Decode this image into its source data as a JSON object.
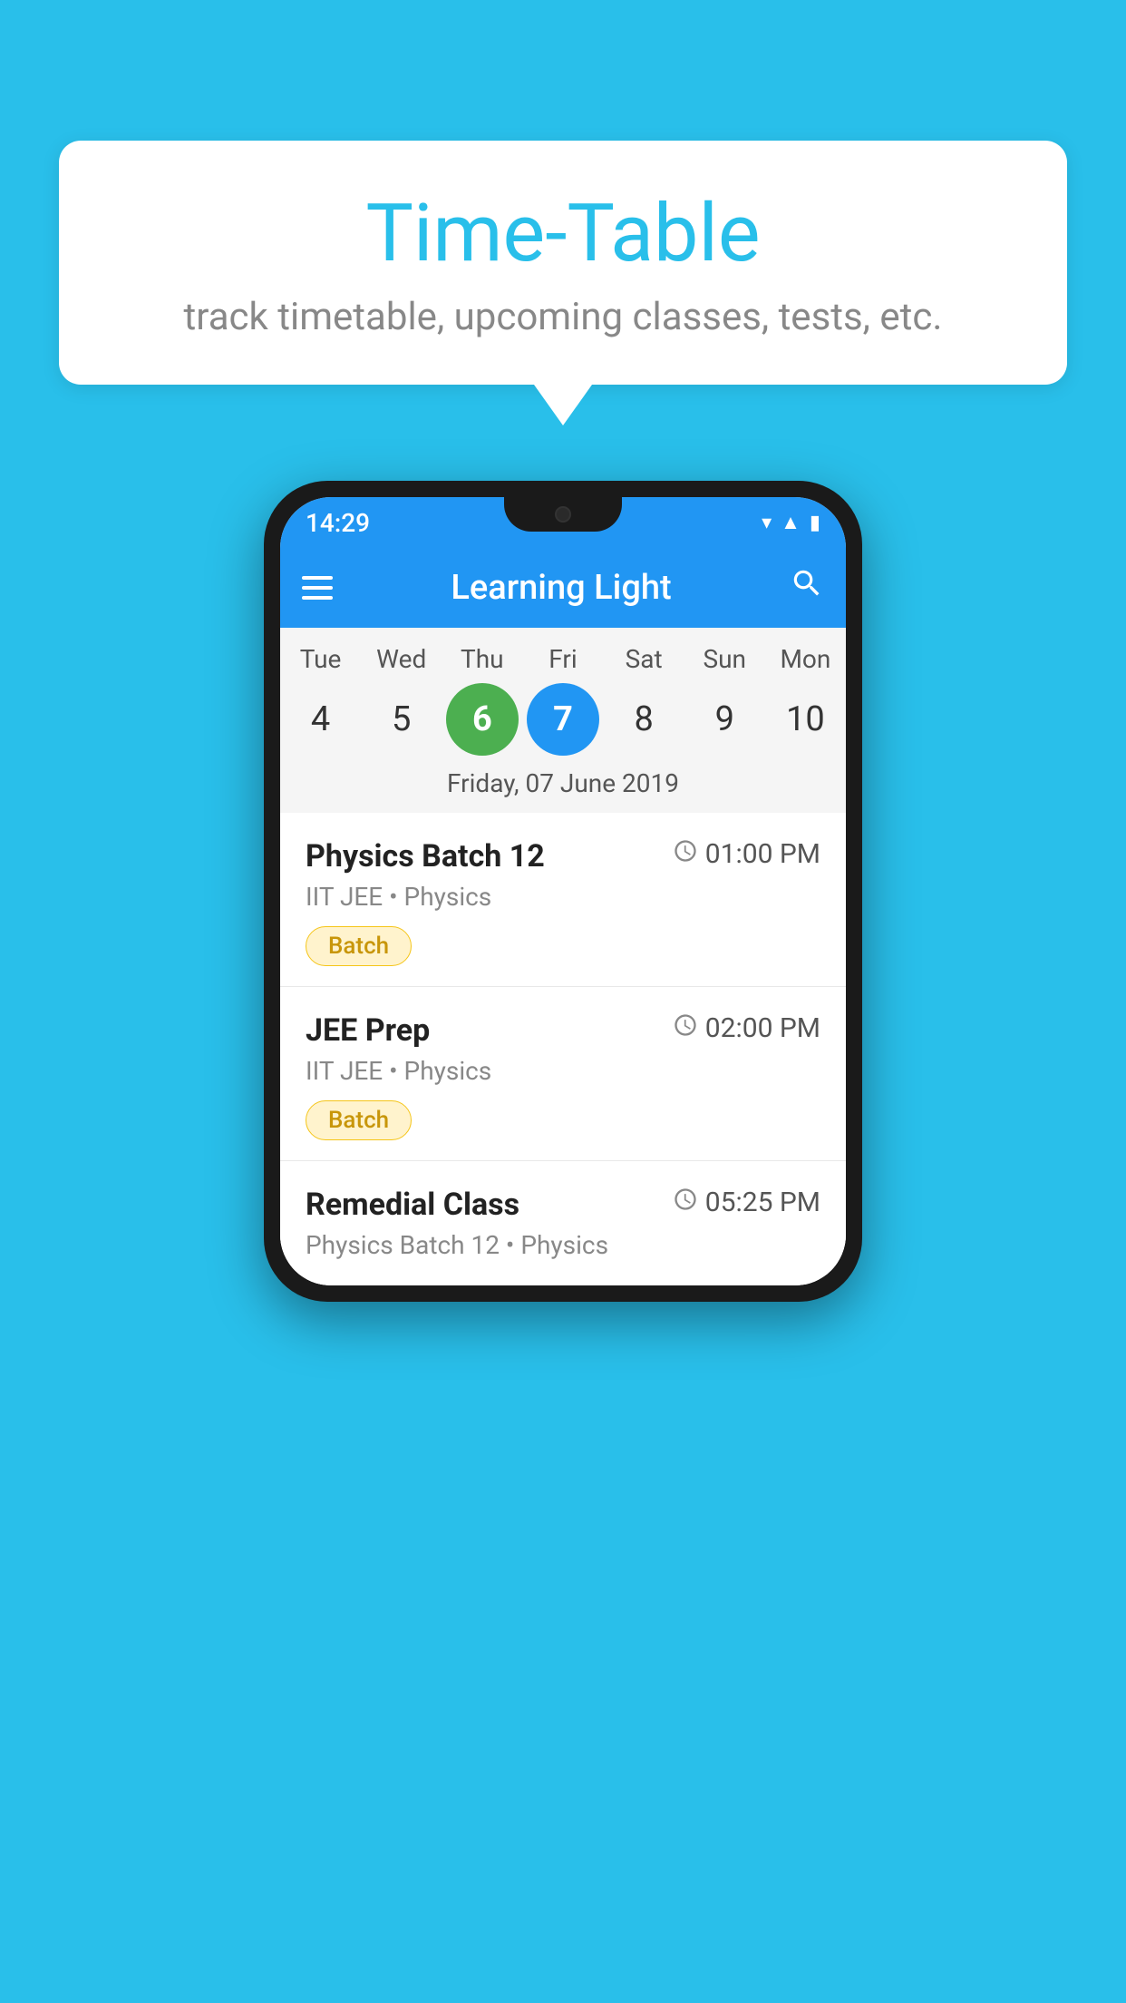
{
  "background_color": "#29BFEA",
  "speech_bubble": {
    "title": "Time-Table",
    "subtitle": "track timetable, upcoming classes, tests, etc."
  },
  "phone": {
    "status_bar": {
      "time": "14:29"
    },
    "app_bar": {
      "title": "Learning Light"
    },
    "calendar": {
      "days": [
        {
          "label": "Tue",
          "number": "4",
          "state": "normal"
        },
        {
          "label": "Wed",
          "number": "5",
          "state": "normal"
        },
        {
          "label": "Thu",
          "number": "6",
          "state": "today"
        },
        {
          "label": "Fri",
          "number": "7",
          "state": "selected"
        },
        {
          "label": "Sat",
          "number": "8",
          "state": "normal"
        },
        {
          "label": "Sun",
          "number": "9",
          "state": "normal"
        },
        {
          "label": "Mon",
          "number": "10",
          "state": "normal"
        }
      ],
      "selected_date_label": "Friday, 07 June 2019"
    },
    "schedule": [
      {
        "title": "Physics Batch 12",
        "time": "01:00 PM",
        "subtitle": "IIT JEE • Physics",
        "badge": "Batch"
      },
      {
        "title": "JEE Prep",
        "time": "02:00 PM",
        "subtitle": "IIT JEE • Physics",
        "badge": "Batch"
      },
      {
        "title": "Remedial Class",
        "time": "05:25 PM",
        "subtitle": "Physics Batch 12 • Physics",
        "badge": null
      }
    ]
  }
}
